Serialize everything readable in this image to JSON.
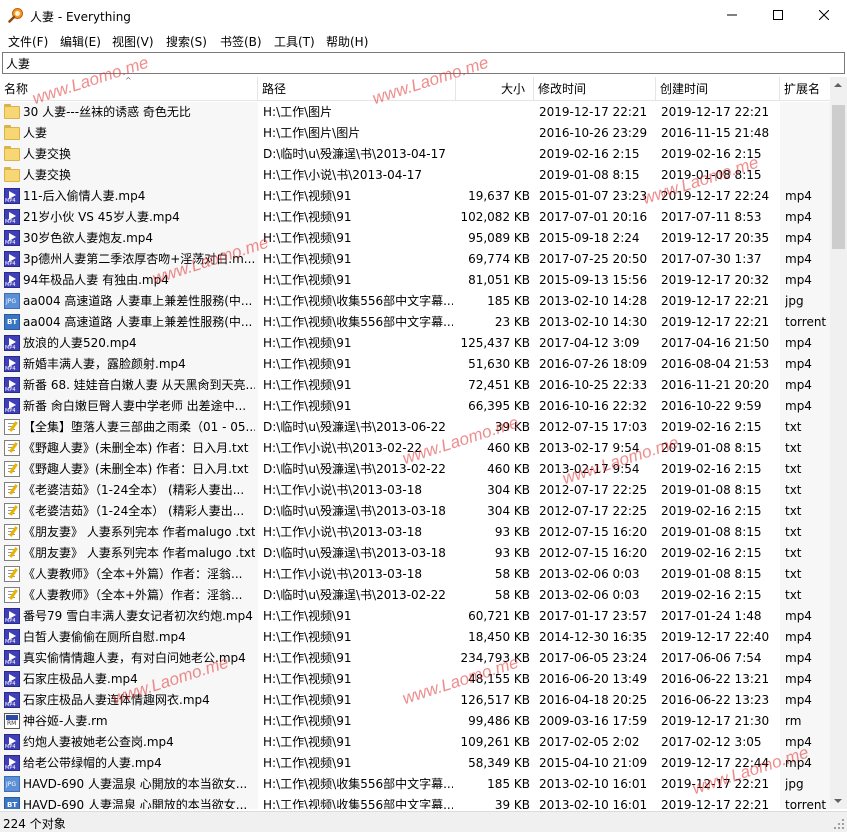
{
  "window": {
    "title": "人妻 - Everything",
    "app_icon": "magnifier-icon",
    "controls": [
      "minimize-icon",
      "maximize-icon",
      "close-icon"
    ]
  },
  "menu": [
    "文件(F)",
    "编辑(E)",
    "视图(V)",
    "搜索(S)",
    "书签(B)",
    "工具(T)",
    "帮助(H)"
  ],
  "search": {
    "value": "人妻"
  },
  "columns": {
    "name": "名称",
    "path": "路径",
    "size": "大小",
    "modified": "修改时间",
    "created": "创建时间",
    "ext": "扩展名"
  },
  "rows": [
    {
      "icon": "folder",
      "name": "30 人妻---丝袜的诱惑 奇色无比",
      "path": "H:\\工作\\图片",
      "size": "",
      "modified": "2019-12-17 22:21",
      "created": "2019-12-17 22:21",
      "ext": ""
    },
    {
      "icon": "folder",
      "name": "人妻",
      "path": "H:\\工作\\图片\\图片",
      "size": "",
      "modified": "2016-10-26 23:29",
      "created": "2016-11-15 21:48",
      "ext": ""
    },
    {
      "icon": "folder",
      "name": "人妻交换",
      "path": "D:\\临时\\u\\殁濂逞\\书\\2013-04-17",
      "size": "",
      "modified": "2019-02-16 2:15",
      "created": "2019-02-16 2:15",
      "ext": ""
    },
    {
      "icon": "folder",
      "name": "人妻交换",
      "path": "H:\\工作\\小说\\书\\2013-04-17",
      "size": "",
      "modified": "2019-01-08 8:15",
      "created": "2019-01-08 8:15",
      "ext": ""
    },
    {
      "icon": "mp4",
      "name": "11-后入偷情人妻.mp4",
      "path": "H:\\工作\\视频\\91",
      "size": "19,637 KB",
      "modified": "2015-01-07 23:23",
      "created": "2019-12-17 22:24",
      "ext": "mp4"
    },
    {
      "icon": "mp4",
      "name": "21岁小伙 VS 45岁人妻.mp4",
      "path": "H:\\工作\\视频\\91",
      "size": "102,082 KB",
      "modified": "2017-07-01 20:16",
      "created": "2017-07-11 8:53",
      "ext": "mp4"
    },
    {
      "icon": "mp4",
      "name": "30岁色欲人妻炮友.mp4",
      "path": "H:\\工作\\视频\\91",
      "size": "95,089 KB",
      "modified": "2015-09-18 2:24",
      "created": "2019-12-17 20:35",
      "ext": "mp4"
    },
    {
      "icon": "mp4",
      "name": "3p德州人妻第二季浓厚杏吻+淫荡对白.m...",
      "path": "H:\\工作\\视频\\91",
      "size": "69,774 KB",
      "modified": "2017-07-25 20:50",
      "created": "2017-07-30 1:37",
      "ext": "mp4"
    },
    {
      "icon": "mp4",
      "name": "94年极品人妻 有独由.mp4",
      "path": "H:\\工作\\视频\\91",
      "size": "81,051 KB",
      "modified": "2015-09-13 15:56",
      "created": "2019-12-17 20:32",
      "ext": "mp4"
    },
    {
      "icon": "jpg",
      "name": "aa004 高速道路 人妻車上兼差性服務(中...",
      "path": "H:\\工作\\视频\\收集556部中文字幕...",
      "size": "185 KB",
      "modified": "2013-02-10 14:28",
      "created": "2019-12-17 22:21",
      "ext": "jpg"
    },
    {
      "icon": "bt",
      "name": "aa004 高速道路 人妻車上兼差性服務(中...",
      "path": "H:\\工作\\视频\\收集556部中文字幕...",
      "size": "23 KB",
      "modified": "2013-02-10 14:30",
      "created": "2019-12-17 22:21",
      "ext": "torrent"
    },
    {
      "icon": "mp4",
      "name": "放浪的人妻520.mp4",
      "path": "H:\\工作\\视频\\91",
      "size": "125,437 KB",
      "modified": "2017-04-12 3:09",
      "created": "2017-04-16 21:50",
      "ext": "mp4"
    },
    {
      "icon": "mp4",
      "name": "新婚丰满人妻，露脸颜射.mp4",
      "path": "H:\\工作\\视频\\91",
      "size": "51,630 KB",
      "modified": "2016-07-26 18:09",
      "created": "2016-08-04 21:53",
      "ext": "mp4"
    },
    {
      "icon": "mp4",
      "name": "新番 68. 娃娃音白嫩人妻 从天黑肏到天亮...",
      "path": "H:\\工作\\视频\\91",
      "size": "72,451 KB",
      "modified": "2016-10-25 22:33",
      "created": "2016-11-21 20:20",
      "ext": "mp4"
    },
    {
      "icon": "mp4",
      "name": "新番 肏白嫩巨臀人妻中学老师 出差途中...",
      "path": "H:\\工作\\视频\\91",
      "size": "66,395 KB",
      "modified": "2016-10-16 22:32",
      "created": "2016-10-22 9:59",
      "ext": "mp4"
    },
    {
      "icon": "txt",
      "name": "【全集】堕落人妻三部曲之雨柔（01 - 05...",
      "path": "D:\\临时\\u\\殁濂逞\\书\\2013-06-22",
      "size": "39 KB",
      "modified": "2012-07-15 17:03",
      "created": "2019-02-16 2:15",
      "ext": "txt"
    },
    {
      "icon": "txt",
      "name": "《野趣人妻》(未删全本) 作者：日入月.txt",
      "path": "H:\\工作\\小说\\书\\2013-02-22",
      "size": "460 KB",
      "modified": "2013-02-17 9:54",
      "created": "2019-01-08 8:15",
      "ext": "txt"
    },
    {
      "icon": "txt",
      "name": "《野趣人妻》(未删全本) 作者：日入月.txt",
      "path": "D:\\临时\\u\\殁濂逞\\书\\2013-02-22",
      "size": "460 KB",
      "modified": "2013-02-17 9:54",
      "created": "2019-02-16 2:15",
      "ext": "txt"
    },
    {
      "icon": "txt",
      "name": "《老婆洁茹》（1-24全本）  (精彩人妻出...",
      "path": "H:\\工作\\小说\\书\\2013-03-18",
      "size": "304 KB",
      "modified": "2012-07-17 22:25",
      "created": "2019-01-08 8:15",
      "ext": "txt"
    },
    {
      "icon": "txt",
      "name": "《老婆洁茹》（1-24全本）  (精彩人妻出...",
      "path": "D:\\临时\\u\\殁濂逞\\书\\2013-03-18",
      "size": "304 KB",
      "modified": "2012-07-17 22:25",
      "created": "2019-02-16 2:15",
      "ext": "txt"
    },
    {
      "icon": "txt",
      "name": "《朋友妻》 人妻系列完本 作者malugo .txt",
      "path": "H:\\工作\\小说\\书\\2013-03-18",
      "size": "93 KB",
      "modified": "2012-07-15 16:20",
      "created": "2019-01-08 8:15",
      "ext": "txt"
    },
    {
      "icon": "txt",
      "name": "《朋友妻》 人妻系列完本 作者malugo .txt",
      "path": "D:\\临时\\u\\殁濂逞\\书\\2013-03-18",
      "size": "93 KB",
      "modified": "2012-07-15 16:20",
      "created": "2019-02-16 2:15",
      "ext": "txt"
    },
    {
      "icon": "txt",
      "name": "《人妻教师》（全本+外篇）作者：淫翁...",
      "path": "H:\\工作\\小说\\书\\2013-03-18",
      "size": "58 KB",
      "modified": "2013-02-06 0:03",
      "created": "2019-01-08 8:15",
      "ext": "txt"
    },
    {
      "icon": "txt",
      "name": "《人妻教师》（全本+外篇）作者：淫翁...",
      "path": "D:\\临时\\u\\殁濂逞\\书\\2013-02-22",
      "size": "58 KB",
      "modified": "2013-02-06 0:03",
      "created": "2019-02-16 2:15",
      "ext": "txt"
    },
    {
      "icon": "mp4",
      "name": "番号79 雪白丰满人妻女记者初次约炮.mp4",
      "path": "H:\\工作\\视频\\91",
      "size": "60,721 KB",
      "modified": "2017-01-17 23:57",
      "created": "2017-01-24 1:48",
      "ext": "mp4"
    },
    {
      "icon": "mp4",
      "name": "白皙人妻偷偷在厕所自慰.mp4",
      "path": "H:\\工作\\视频\\91",
      "size": "18,450 KB",
      "modified": "2014-12-30 16:35",
      "created": "2019-12-17 22:40",
      "ext": "mp4"
    },
    {
      "icon": "mp4",
      "name": "真实偷情情趣人妻，有对白问她老公.mp4",
      "path": "H:\\工作\\视频\\91",
      "size": "234,793 KB",
      "modified": "2017-06-05 23:24",
      "created": "2017-06-06 7:54",
      "ext": "mp4"
    },
    {
      "icon": "mp4",
      "name": "石家庄极品人妻.mp4",
      "path": "H:\\工作\\视频\\91",
      "size": "48,155 KB",
      "modified": "2016-06-20 13:49",
      "created": "2016-06-22 13:21",
      "ext": "mp4"
    },
    {
      "icon": "mp4",
      "name": "石家庄极品人妻连体情趣网衣.mp4",
      "path": "H:\\工作\\视频\\91",
      "size": "126,517 KB",
      "modified": "2016-04-18 20:25",
      "created": "2016-06-22 13:23",
      "ext": "mp4"
    },
    {
      "icon": "rm",
      "name": "神谷姬-人妻.rm",
      "path": "H:\\工作\\视频\\91",
      "size": "99,486 KB",
      "modified": "2009-03-16 17:59",
      "created": "2019-12-17 21:30",
      "ext": "rm"
    },
    {
      "icon": "mp4",
      "name": "约炮人妻被她老公查岗.mp4",
      "path": "H:\\工作\\视频\\91",
      "size": "109,261 KB",
      "modified": "2017-02-05 2:02",
      "created": "2017-02-12 3:05",
      "ext": "mp4"
    },
    {
      "icon": "mp4",
      "name": "给老公带绿帽的人妻.mp4",
      "path": "H:\\工作\\视频\\91",
      "size": "58,349 KB",
      "modified": "2015-04-10 21:09",
      "created": "2019-12-17 22:44",
      "ext": "mp4"
    },
    {
      "icon": "jpg",
      "name": "HAVD-690 人妻温泉 心開放的本当欲女...",
      "path": "H:\\工作\\视频\\收集556部中文字幕...",
      "size": "185 KB",
      "modified": "2013-02-10 16:01",
      "created": "2019-12-17 22:21",
      "ext": "jpg"
    },
    {
      "icon": "bt",
      "name": "HAVD-690 人妻温泉 心開放的本当欲女...",
      "path": "H:\\工作\\视频\\收集556部中文字幕...",
      "size": "39 KB",
      "modified": "2013-02-10 16:01",
      "created": "2019-12-17 22:21",
      "ext": "torrent"
    }
  ],
  "status": {
    "text": "224 个对象"
  },
  "watermark": "www.Laomo.me",
  "colors": {
    "watermark": "#e22d2d",
    "folder": "#f7d774",
    "mp4": "#3f3fb8"
  }
}
